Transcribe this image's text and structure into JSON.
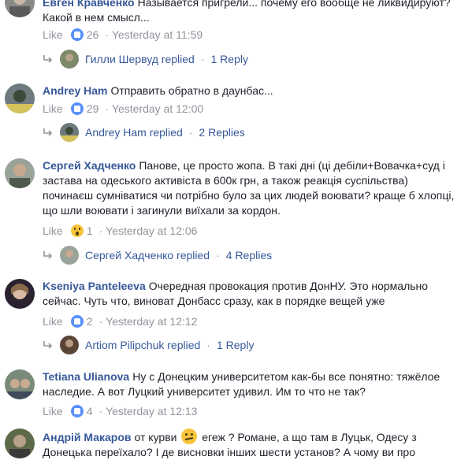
{
  "comments": [
    {
      "name": "Евген Кравченко",
      "text": "Называется пригрели... почему его вообще не ликвидируют? Какой в нем смысл...",
      "like_label": "Like",
      "reaction_count": "26",
      "time": "Yesterday at 11:59",
      "reply": {
        "name": "Гилли Шервуд replied",
        "count": "1 Reply"
      }
    },
    {
      "name": "Andrey Ham",
      "text": "Отправить обратно в даунбас...",
      "like_label": "Like",
      "reaction_count": "29",
      "time": "Yesterday at 12:00",
      "reply": {
        "name": "Andrey Ham replied",
        "count": "2 Replies"
      }
    },
    {
      "name": "Сергей Хадченко",
      "text": "Панове, це просто жопа. В такі дні (ці дебіли+Вовачка+суд і застава на одеського активіста в 600к грн, а також реакція суспільства) починаєш сумніватися чи потрібно було за цих людей воювати? краще б хлопці, що шли воювати і загинули виїхали за кордон.",
      "like_label": "Like",
      "reaction_count": "1",
      "time": "Yesterday at 12:06",
      "reply": {
        "name": "Сергей Хадченко replied",
        "count": "4 Replies"
      }
    },
    {
      "name": "Kseniya Panteleeva",
      "text": "Очередная провокация против ДонНУ. Это нормально сейчас. Чуть что, виноват Донбасс сразу, как в порядке вещей уже",
      "like_label": "Like",
      "reaction_count": "2",
      "time": "Yesterday at 12:12",
      "reply": {
        "name": "Artiom Pilipchuk replied",
        "count": "1 Reply"
      }
    },
    {
      "name": "Tetiana Ulianova",
      "text": "Ну с Донецким университетом как-бы все понятно: тяжёлое наследие. А вот Луцкий университет удивил. Им то что не так?",
      "like_label": "Like",
      "reaction_count": "4",
      "time": "Yesterday at 12:13"
    },
    {
      "name": "Андрій Макаров",
      "text_a": "от курви",
      "text_b": "егеж ? Романе, а що там в Луцьк, Одесу з Донецька переїхало? І де висновки інших шести установ? А чому ви про"
    }
  ],
  "separator": "·",
  "colors": {
    "link": "#365899",
    "meta": "#90949c",
    "text": "#1d2129",
    "like_icon": "#5890ff"
  }
}
